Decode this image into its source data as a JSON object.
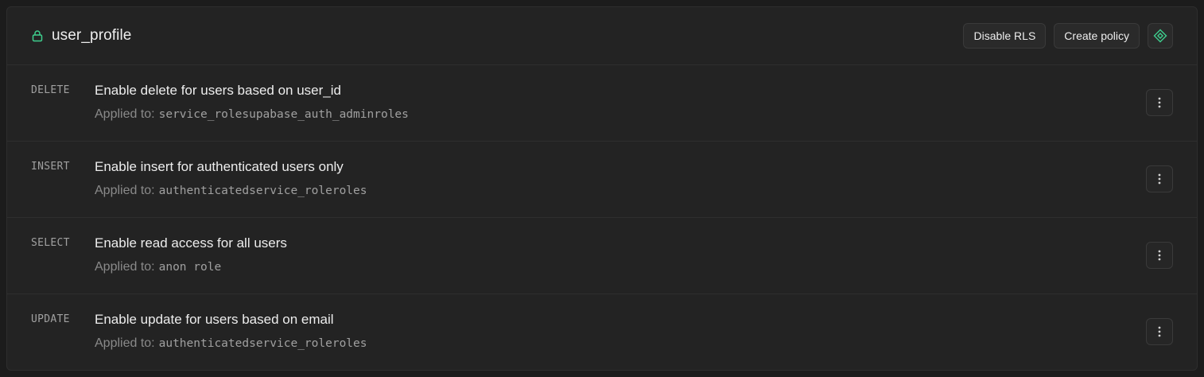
{
  "table": {
    "name": "user_profile",
    "lock_icon": "lock-icon",
    "accent": "#3ecf8e"
  },
  "actions": {
    "disable_rls": "Disable RLS",
    "create_policy": "Create policy",
    "api_icon": "diamond-icon"
  },
  "policies": [
    {
      "command": "DELETE",
      "name": "Enable delete for users based on user_id",
      "applied_label": "Applied to:",
      "roles": "service_rolesupabase_auth_adminroles"
    },
    {
      "command": "INSERT",
      "name": "Enable insert for authenticated users only",
      "applied_label": "Applied to:",
      "roles": "authenticatedservice_roleroles"
    },
    {
      "command": "SELECT",
      "name": "Enable read access for all users",
      "applied_label": "Applied to:",
      "roles": "anon role"
    },
    {
      "command": "UPDATE",
      "name": "Enable update for users based on email",
      "applied_label": "Applied to:",
      "roles": "authenticatedservice_roleroles"
    }
  ]
}
